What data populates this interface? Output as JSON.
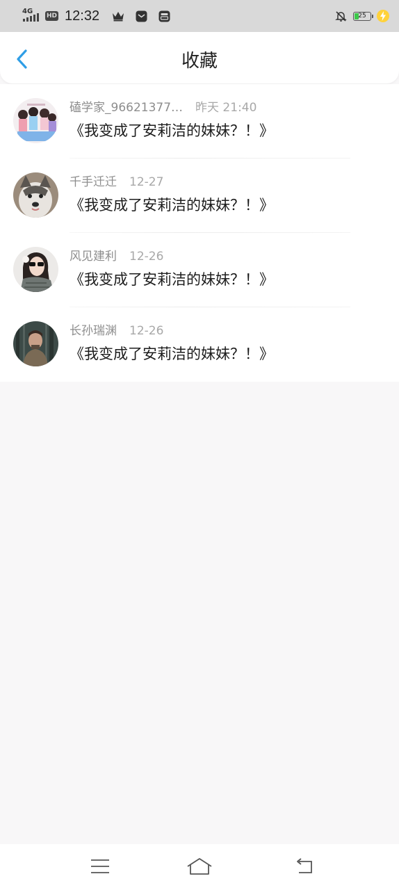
{
  "status_bar": {
    "network": "4G",
    "hd": "HD",
    "time": "12:32",
    "battery_level": "25",
    "battery_fraction": 0.25,
    "icons": [
      "crown-icon",
      "mail-icon",
      "sim-card-icon",
      "mute-bell-icon",
      "battery-icon",
      "charging-icon"
    ]
  },
  "header": {
    "title": "收藏",
    "back_icon": "chevron-left-icon"
  },
  "favorites": [
    {
      "user": "磕学家_96621377…",
      "time": "昨天 21:40",
      "title": "《我变成了安莉洁的妹妹？！》",
      "avatar": "group-cartoon"
    },
    {
      "user": "千手迁迁",
      "time": "12-27",
      "title": "《我变成了安莉洁的妹妹？！》",
      "avatar": "husky"
    },
    {
      "user": "风见建利",
      "time": "12-26",
      "title": "《我变成了安莉洁的妹妹？！》",
      "avatar": "woman-sunglasses"
    },
    {
      "user": "长孙瑞渊",
      "time": "12-26",
      "title": "《我变成了安莉洁的妹妹？！》",
      "avatar": "man-forest"
    }
  ],
  "nav_bar": {
    "icons": [
      "menu-icon",
      "home-icon",
      "back-icon"
    ]
  },
  "colors": {
    "accent": "#2f9ee6",
    "status_bar_bg": "#d9d9d9",
    "page_bg": "#f8f7f8",
    "battery_green": "#3cc94a",
    "charging_yellow": "#ffd23a"
  }
}
